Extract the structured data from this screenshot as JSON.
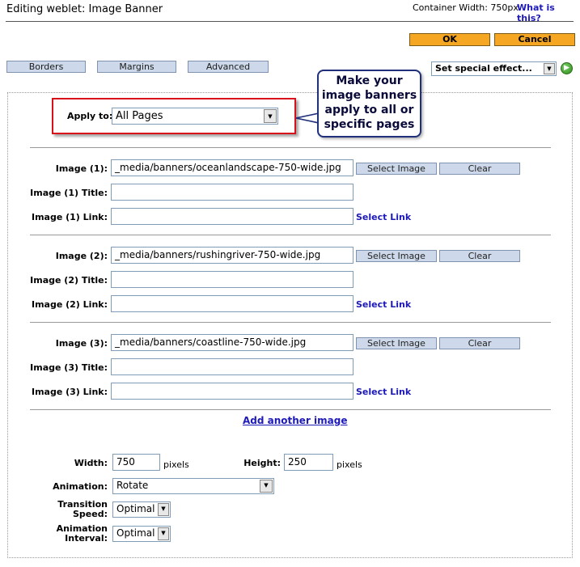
{
  "header": {
    "title": "Editing weblet: Image Banner",
    "container_width": "Container Width: 750px",
    "help_link": "What is this?"
  },
  "actions": {
    "ok_label": "OK",
    "cancel_label": "Cancel"
  },
  "tabs": [
    "Borders",
    "Margins",
    "Advanced"
  ],
  "special_effect": {
    "selected": "Set special effect..."
  },
  "apply": {
    "label": "Apply to:",
    "selected": "All Pages"
  },
  "callout": {
    "text": "Make your image banners apply to all or specific pages"
  },
  "images": [
    {
      "image_label": "Image (1):",
      "image_value": "_media/banners/oceanlandscape-750-wide.jpg",
      "title_label": "Image (1) Title:",
      "title_value": "",
      "link_label": "Image (1) Link:",
      "link_value": ""
    },
    {
      "image_label": "Image (2):",
      "image_value": "_media/banners/rushingriver-750-wide.jpg",
      "title_label": "Image (2) Title:",
      "title_value": "",
      "link_label": "Image (2) Link:",
      "link_value": ""
    },
    {
      "image_label": "Image (3):",
      "image_value": "_media/banners/coastline-750-wide.jpg",
      "title_label": "Image (3) Title:",
      "title_value": "",
      "link_label": "Image (3) Link:",
      "link_value": ""
    }
  ],
  "image_buttons": {
    "select_image": "Select Image",
    "clear": "Clear",
    "select_link": "Select Link"
  },
  "add_image_link": "Add another image",
  "settings": {
    "width_label": "Width:",
    "width_value": "750",
    "width_unit": "pixels",
    "height_label": "Height:",
    "height_value": "250",
    "height_unit": "pixels",
    "animation_label": "Animation:",
    "animation_value": "Rotate",
    "transition_label_1": "Transition",
    "transition_label_2": "Speed:",
    "transition_value": "Optimal",
    "interval_label_1": "Animation",
    "interval_label_2": "Interval:",
    "interval_value": "Optimal"
  },
  "colors": {
    "accent_button": "#f5a623",
    "tab_button": "#cdd9ea",
    "link": "#1d1ab8",
    "highlight_box": "#d8101a"
  }
}
